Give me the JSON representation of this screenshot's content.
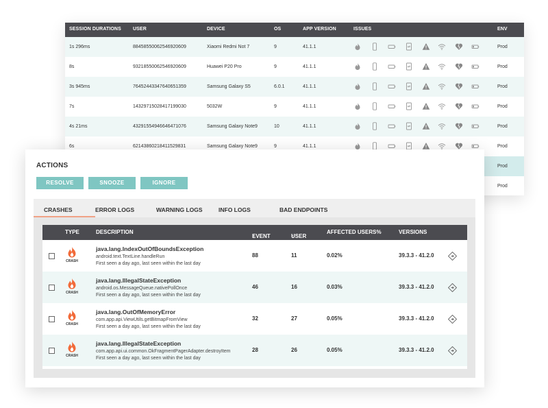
{
  "sessions": {
    "headers": [
      "SESSION DURATIONS",
      "USER",
      "DEVICE",
      "OS",
      "APP VERSION",
      "ISSUES",
      "ENV"
    ],
    "issue_icons": [
      "fire-icon",
      "phone-icon",
      "battery-icon",
      "memory-card-icon",
      "warning-icon",
      "wifi-icon",
      "heart-broken-icon",
      "battery-low-icon"
    ],
    "rows": [
      {
        "duration": "1s 296ms",
        "user": "88458550062546920609",
        "device": "Xiaomi Redmi Not 7",
        "os": "9",
        "version": "41.1.1",
        "env": "Prod"
      },
      {
        "duration": "8s",
        "user": "93218550062546920609",
        "device": "Huawei P20 Pro",
        "os": "9",
        "version": "41.1.1",
        "env": "Prod"
      },
      {
        "duration": "3s 945ms",
        "user": "76452443347640651359",
        "device": "Samsung Galaxy S5",
        "os": "6.0.1",
        "version": "41.1.1",
        "env": "Prod"
      },
      {
        "duration": "7s",
        "user": "14329715028417199030",
        "device": "5032W",
        "os": "9",
        "version": "41.1.1",
        "env": "Prod"
      },
      {
        "duration": "4s 21ms",
        "user": "43291554946646471076",
        "device": "Samsung Galaxy Note9",
        "os": "10",
        "version": "41.1.1",
        "env": "Prod"
      },
      {
        "duration": "6s",
        "user": "62143860218411529831",
        "device": "Samsung Galaxy Note9",
        "os": "9",
        "version": "41.1.1",
        "env": "Prod"
      },
      {
        "duration": "",
        "user": "",
        "device": "",
        "os": "",
        "version": "",
        "env": "Prod"
      },
      {
        "duration": "",
        "user": "",
        "device": "",
        "os": "",
        "version": "",
        "env": "Prod"
      }
    ],
    "highlight_color": "#d3ecec"
  },
  "actions": {
    "title": "ACTIONS",
    "buttons": [
      "RESOLVE",
      "SNOOZE",
      "IGNORE"
    ],
    "button_color": "#7fc6c2"
  },
  "tabs": [
    "CRASHES",
    "ERROR LOGS",
    "WARNING LOGS",
    "INFO LOGS",
    "BAD ENDPOINTS"
  ],
  "active_tab": "CRASHES",
  "crashes": {
    "headers": {
      "type": "TYPE",
      "description": "DESCRIPTION",
      "event": "EVENT",
      "user": "USER",
      "affected": "AFFECTED USERS%",
      "versions": "VERSIONS"
    },
    "type_label": "CRASH",
    "rows": [
      {
        "title": "java.lang.IndexOutOfBoundsException",
        "source": "android.text.TextLine.handleRun",
        "seen": "First seen a day ago, last seen within the last day",
        "event": "88",
        "user": "11",
        "affected": "0.02%",
        "versions": "39.3.3 - 41.2.0"
      },
      {
        "title": "java.lang.IllegalStateException",
        "source": "android.os.MessageQueue.nativePollOnce",
        "seen": "First seen a day ago, last seen within the last day",
        "event": "46",
        "user": "16",
        "affected": "0.03%",
        "versions": "39.3.3 - 41.2.0"
      },
      {
        "title": "java.lang.OutOfMemoryError",
        "source": "com.app.api.ViewUtils.getBitmapFromView",
        "seen": "First seen a day ago, last seen within the last day",
        "event": "32",
        "user": "27",
        "affected": "0.05%",
        "versions": "39.3.3 - 41.2.0"
      },
      {
        "title": "java.lang.IllegalStateException",
        "source": "com.app.api.ui.common.OkFragmentPagerAdapter.destroyItem",
        "seen": "First seen a day ago, last seen within the last day",
        "event": "28",
        "user": "26",
        "affected": "0.05%",
        "versions": "39.3.3 - 41.2.0"
      }
    ],
    "crash_icon_color": "#f26b3a",
    "header_color": "#4b4b50"
  }
}
